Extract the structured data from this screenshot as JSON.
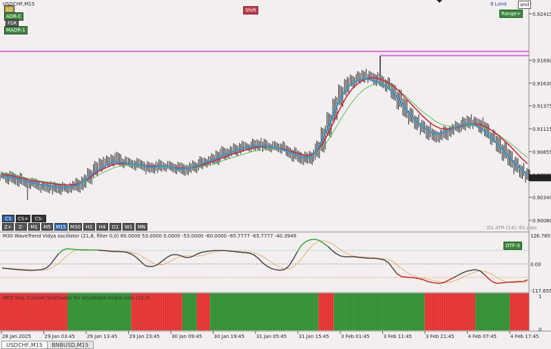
{
  "window": {
    "symbol_title": "USDCHF,M15"
  },
  "top_labels": {
    "center": "Shift",
    "right_small": "8 Lond",
    "right_corner": "and",
    "right_green": "Range+"
  },
  "left_labels": [
    {
      "text": "LO",
      "color": "#b9a13a"
    },
    {
      "text": "ADR-C",
      "color": "#3a8a3a"
    },
    {
      "text": "FSR",
      "color": "#555555"
    },
    {
      "text": "MADR-1",
      "color": "#3a8a3a"
    }
  ],
  "cs_buttons": [
    "CS",
    "CS+",
    "CS-"
  ],
  "timeframes": [
    "Z+",
    "Z-",
    "M1",
    "M5",
    "M15",
    "M30",
    "H1",
    "H4",
    "D1",
    "W1",
    "MN"
  ],
  "active_timeframe": "M15",
  "price_axis": {
    "ticks": [
      "0.92415",
      "0.91890",
      "0.91630",
      "0.91375",
      "0.91115",
      "0.90855",
      "0.90595",
      "0.90340",
      "0.90080"
    ]
  },
  "atr_label": "D1 ATR (14): 61 pips",
  "oscillator": {
    "title": "M30 WaveTrend Vidya oscillator (21,8, filter 0,0) 60.0000 53.0000 0.0000 -53.0000 -60.0000 -65.7777 -65.7777 -40.3949",
    "ticks": [
      "126.7857",
      "0.00",
      "-117.6591"
    ],
    "badge": "OTF-3"
  },
  "histogram": {
    "title": "MCS Seq. Custom Stochastic for smoothed Heikin Ashi (10,0)",
    "ticks": [
      "1",
      "0"
    ],
    "segments": [
      {
        "color": "red",
        "w": 12.7
      },
      {
        "color": "green",
        "w": 12.0
      },
      {
        "color": "red",
        "w": 9.6
      },
      {
        "color": "green",
        "w": 2.7
      },
      {
        "color": "red",
        "w": 2.5
      },
      {
        "color": "green",
        "w": 20.4
      },
      {
        "color": "red",
        "w": 2.9
      },
      {
        "color": "green",
        "w": 17.1
      },
      {
        "color": "red",
        "w": 9.5
      },
      {
        "color": "green",
        "w": 6.5
      },
      {
        "color": "red",
        "w": 3.6
      }
    ]
  },
  "time_axis": {
    "labels": [
      "28 Jan 2025",
      "29 Jan 03:45",
      "29 Jan 13:45",
      "29 Jan 23:45",
      "30 Jan 09:45",
      "30 Jan 19:45",
      "31 Jan 05:45",
      "31 Jan 15:45",
      "3 Feb 01:45",
      "3 Feb 11:45",
      "3 Feb 21:45",
      "4 Feb 07:45",
      "4 Feb 17:45"
    ]
  },
  "tabs": [
    {
      "label": "USDCHF,M15",
      "active": true
    },
    {
      "label": "BNBUSD,M15",
      "active": false
    }
  ],
  "colors": {
    "candle": "#222222",
    "ma_red": "#d0253a",
    "ma_blue": "#3d93c9",
    "ma_green": "#5bbd5b",
    "level_line": "#d46bd6",
    "hist_red": "#ee3b3b",
    "hist_green": "#3a9a3a"
  },
  "chart_data": {
    "type": "line",
    "price_ylim": [
      0.9008,
      0.92415
    ],
    "close": [
      0.9058,
      0.9056,
      0.9054,
      0.9052,
      0.905,
      0.9049,
      0.9047,
      0.9046,
      0.9045,
      0.9044,
      0.9043,
      0.9044,
      0.9046,
      0.9049,
      0.9055,
      0.9062,
      0.9068,
      0.9072,
      0.9076,
      0.9078,
      0.9075,
      0.9073,
      0.9072,
      0.907,
      0.9069,
      0.9067,
      0.9068,
      0.907,
      0.9069,
      0.9067,
      0.9065,
      0.9066,
      0.9068,
      0.907,
      0.9073,
      0.9075,
      0.9078,
      0.9082,
      0.9084,
      0.9086,
      0.9089,
      0.9091,
      0.9092,
      0.9094,
      0.9093,
      0.9092,
      0.9091,
      0.909,
      0.9088,
      0.9085,
      0.9081,
      0.9078,
      0.9076,
      0.9082,
      0.9092,
      0.9108,
      0.9125,
      0.9142,
      0.9155,
      0.9163,
      0.9168,
      0.917,
      0.9172,
      0.917,
      0.9166,
      0.9162,
      0.9158,
      0.915,
      0.914,
      0.913,
      0.9122,
      0.9115,
      0.911,
      0.9106,
      0.9102,
      0.9104,
      0.9108,
      0.9112,
      0.9115,
      0.9118,
      0.912,
      0.9118,
      0.9112,
      0.9105,
      0.9098,
      0.909,
      0.9082,
      0.9074,
      0.9066,
      0.906,
      0.9056
    ],
    "ma_red": [
      0.906,
      0.9059,
      0.9058,
      0.9056,
      0.9055,
      0.9053,
      0.9052,
      0.9051,
      0.905,
      0.9049,
      0.9048,
      0.9048,
      0.9048,
      0.9049,
      0.9052,
      0.9056,
      0.9061,
      0.9065,
      0.9068,
      0.9071,
      0.9072,
      0.9072,
      0.9072,
      0.9071,
      0.907,
      0.9069,
      0.9069,
      0.9069,
      0.9069,
      0.9068,
      0.9067,
      0.9067,
      0.9067,
      0.9068,
      0.907,
      0.9072,
      0.9074,
      0.9077,
      0.9079,
      0.9082,
      0.9084,
      0.9086,
      0.9088,
      0.909,
      0.9091,
      0.9091,
      0.9091,
      0.909,
      0.9089,
      0.9087,
      0.9085,
      0.9083,
      0.9081,
      0.9082,
      0.9087,
      0.9096,
      0.9108,
      0.9122,
      0.9136,
      0.9148,
      0.9157,
      0.9163,
      0.9167,
      0.9169,
      0.9169,
      0.9167,
      0.9164,
      0.916,
      0.9154,
      0.9147,
      0.914,
      0.9133,
      0.9126,
      0.912,
      0.9115,
      0.9112,
      0.9111,
      0.9112,
      0.9113,
      0.9115,
      0.9117,
      0.9117,
      0.9116,
      0.9113,
      0.9109,
      0.9104,
      0.9098,
      0.9092,
      0.9085,
      0.9078,
      0.9072
    ],
    "ma_blue": [
      0.9058,
      0.9057,
      0.9056,
      0.9054,
      0.9052,
      0.9051,
      0.9049,
      0.9048,
      0.9047,
      0.9046,
      0.9045,
      0.9045,
      0.9046,
      0.9048,
      0.9052,
      0.9058,
      0.9063,
      0.9067,
      0.9071,
      0.9074,
      0.9074,
      0.9073,
      0.9072,
      0.9071,
      0.907,
      0.9068,
      0.9068,
      0.9069,
      0.9069,
      0.9068,
      0.9066,
      0.9066,
      0.9067,
      0.9069,
      0.9071,
      0.9074,
      0.9076,
      0.9079,
      0.9082,
      0.9084,
      0.9087,
      0.9089,
      0.909,
      0.9092,
      0.9092,
      0.9092,
      0.9091,
      0.909,
      0.9088,
      0.9086,
      0.9083,
      0.908,
      0.9078,
      0.908,
      0.9088,
      0.9101,
      0.9116,
      0.9132,
      0.9146,
      0.9157,
      0.9163,
      0.9166,
      0.9168,
      0.9167,
      0.9165,
      0.9162,
      0.9158,
      0.9152,
      0.9144,
      0.9135,
      0.9127,
      0.912,
      0.9114,
      0.9109,
      0.9106,
      0.9106,
      0.9108,
      0.9111,
      0.9114,
      0.9116,
      0.9117,
      0.9116,
      0.9112,
      0.9106,
      0.91,
      0.9093,
      0.9086,
      0.9078,
      0.9071,
      0.9065,
      0.906
    ],
    "ma_green": [
      0.9062,
      0.9061,
      0.9059,
      0.9058,
      0.9056,
      0.9055,
      0.9053,
      0.9052,
      0.9051,
      0.905,
      0.9049,
      0.9048,
      0.9048,
      0.9048,
      0.905,
      0.9053,
      0.9057,
      0.9061,
      0.9064,
      0.9067,
      0.9069,
      0.907,
      0.907,
      0.907,
      0.9069,
      0.9069,
      0.9068,
      0.9068,
      0.9068,
      0.9068,
      0.9067,
      0.9067,
      0.9067,
      0.9067,
      0.9068,
      0.907,
      0.9071,
      0.9073,
      0.9076,
      0.9078,
      0.908,
      0.9082,
      0.9084,
      0.9086,
      0.9087,
      0.9088,
      0.9088,
      0.9088,
      0.9087,
      0.9086,
      0.9085,
      0.9083,
      0.9082,
      0.9082,
      0.9085,
      0.9091,
      0.91,
      0.9111,
      0.9122,
      0.9133,
      0.9142,
      0.915,
      0.9156,
      0.916,
      0.9162,
      0.9162,
      0.9161,
      0.9158,
      0.9154,
      0.9149,
      0.9143,
      0.9137,
      0.9131,
      0.9126,
      0.9121,
      0.9117,
      0.9115,
      0.9114,
      0.9114,
      0.9114,
      0.9115,
      0.9115,
      0.9114,
      0.9112,
      0.9109,
      0.9105,
      0.91,
      0.9095,
      0.909,
      0.9084,
      0.9079
    ],
    "level_line": 0.9199,
    "oscillator_ylim": [
      -117.6591,
      126.7857
    ],
    "oscillator_main": [
      -18,
      -20,
      -22,
      -24,
      -26,
      -27,
      -28,
      -28,
      -27,
      -25,
      -20,
      -5,
      20,
      45,
      62,
      68,
      66,
      64,
      63,
      62,
      62,
      62,
      62,
      60,
      58,
      56,
      55,
      55,
      54,
      50,
      42,
      28,
      10,
      -8,
      -12,
      -10,
      0,
      15,
      30,
      40,
      42,
      38,
      30,
      28,
      35,
      45,
      52,
      55,
      58,
      60,
      60,
      60,
      58,
      56,
      54,
      52,
      50,
      48,
      40,
      25,
      5,
      -10,
      -20,
      -25,
      -28,
      -25,
      -10,
      20,
      55,
      85,
      100,
      108,
      110,
      105,
      92,
      78,
      60,
      45,
      35,
      32,
      32,
      32,
      30,
      28,
      26,
      25,
      25,
      22,
      18,
      5,
      -20,
      -45,
      -56,
      -58,
      -60,
      -62,
      -65,
      -70,
      -78,
      -82,
      -85,
      -86,
      -80,
      -70,
      -60,
      -50,
      -40,
      -32,
      -28,
      -25,
      -30,
      -45,
      -65,
      -80,
      -86,
      -84,
      -82,
      -80,
      -80,
      -78,
      -78,
      -70
    ],
    "histogram_states": "red,green,red,green,red,green,red,green,red,green,red"
  }
}
